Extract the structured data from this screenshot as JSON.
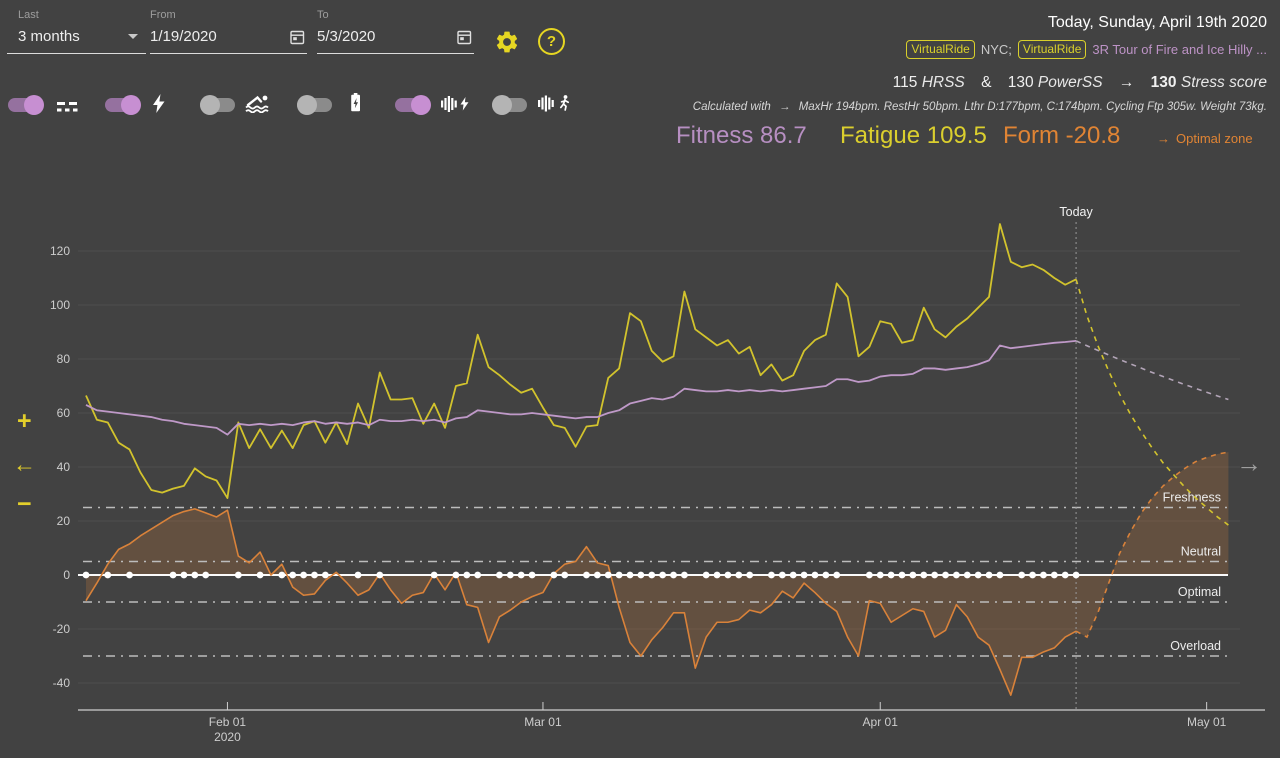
{
  "colors": {
    "background": "#424242",
    "accent_yellow": "#e6d622",
    "fitness_purple": "#b78fc2",
    "fatigue_yellow": "#dbcf2e",
    "form_orange": "#e08434",
    "activity_name_purple": "#bd93c6",
    "toggle_on_purple": "#c78fd2"
  },
  "filters": {
    "last": {
      "label": "Last",
      "value": "3 months"
    },
    "from": {
      "label": "From",
      "value": "1/19/2020"
    },
    "to": {
      "label": "To",
      "value": "5/3/2020"
    }
  },
  "toggles": [
    {
      "name": "trend-lines",
      "on": true
    },
    {
      "name": "power-stress",
      "on": true
    },
    {
      "name": "swim-stress",
      "on": false
    },
    {
      "name": "battery-stress",
      "on": false
    },
    {
      "name": "heart-rate-stress",
      "on": true
    },
    {
      "name": "running-stress",
      "on": false
    }
  ],
  "summary": {
    "date_line": "Today, Sunday, April 19th 2020",
    "activities": [
      {
        "badge": "VirtualRide",
        "name": "NYC;"
      },
      {
        "badge": "VirtualRide",
        "name": "3R Tour of Fire and Ice Hilly ..."
      }
    ],
    "stress": {
      "hrss_value": "115",
      "hrss_label": "HRSS",
      "joiner": "&",
      "powerss_value": "130",
      "powerss_label": "PowerSS",
      "arrow": "→",
      "total_value": "130",
      "total_label": "Stress score"
    },
    "calculated": {
      "prefix": "Calculated with",
      "arrow": "→",
      "details": "MaxHr 194bpm. RestHr 50bpm. Lthr D:177bpm, C:174bpm. Cycling Ftp 305w. Weight 73kg."
    },
    "metrics": [
      {
        "label": "Fitness",
        "value": "86.7"
      },
      {
        "label": "Fatigue",
        "value": "109.5"
      },
      {
        "label": "Form",
        "value": "-20.8"
      }
    ],
    "optimal_zone": {
      "arrow": "→",
      "label": "Optimal zone"
    }
  },
  "controls": {
    "zoom_in": "+",
    "pan_left": "←",
    "zoom_out": "−",
    "pan_right": "→"
  },
  "chart_data": {
    "type": "line",
    "x_start_label": "1/19/2020",
    "x_ticks": [
      {
        "day": 13,
        "label": "Feb 01",
        "sublabel": "2020"
      },
      {
        "day": 42,
        "label": "Mar 01"
      },
      {
        "day": 73,
        "label": "Apr 01"
      },
      {
        "day": 103,
        "label": "May 01"
      }
    ],
    "y_ticks": [
      120,
      100,
      80,
      60,
      40,
      20,
      0,
      -20,
      -40
    ],
    "ylim": [
      -50,
      135
    ],
    "zones": [
      {
        "label": "Freshness",
        "level": 25
      },
      {
        "label": "Neutral",
        "level": 5
      },
      {
        "label": "Optimal",
        "level": -10
      },
      {
        "label": "Overload",
        "level": -30
      }
    ],
    "today": {
      "day": 91,
      "label": "Today"
    },
    "series": [
      {
        "name": "Fitness",
        "color": "#bf99c8",
        "proj_color": "#b3a5b8",
        "values": [
          63,
          61,
          60.5,
          60,
          59.5,
          59,
          58.5,
          57.5,
          57,
          56,
          55.5,
          55,
          54.5,
          52,
          56,
          55.5,
          56,
          55.5,
          56,
          55.5,
          56.5,
          57,
          56,
          56.5,
          56,
          56.5,
          55.5,
          57.5,
          57,
          57,
          57.5,
          57,
          57.5,
          56.5,
          58,
          58.5,
          61,
          60.5,
          60,
          59.5,
          59.5,
          60,
          59.5,
          59,
          58.5,
          58,
          58.5,
          58.5,
          60,
          61,
          63.5,
          64.5,
          65.5,
          65,
          66,
          69,
          68.5,
          68,
          68,
          68.5,
          68,
          68.5,
          68,
          68.5,
          68,
          68.5,
          69,
          69.5,
          70,
          72.5,
          72.5,
          71.5,
          72,
          73.5,
          74,
          74,
          74.5,
          76.5,
          76.5,
          76,
          76.5,
          77,
          78,
          79.5,
          85,
          84,
          84.5,
          85,
          85.5,
          86,
          86.3,
          86.7
        ],
        "projection": [
          86.7,
          84.9,
          83.2,
          81.5,
          79.8,
          78.2,
          76.6,
          75,
          73.5,
          72,
          70.5,
          69.1,
          67.7,
          66.3,
          65
        ]
      },
      {
        "name": "Fatigue",
        "color": "#d2c32d",
        "proj_color": "#d2c32d",
        "values": [
          66.5,
          57.5,
          56.5,
          49,
          46.5,
          38,
          31.5,
          30.5,
          32,
          33,
          39.5,
          36.5,
          35,
          28.5,
          56.5,
          47,
          54,
          47,
          53.5,
          47,
          55.5,
          57,
          49,
          56.5,
          48.5,
          63.5,
          54.5,
          75,
          65,
          65,
          65.5,
          56,
          63.5,
          54.5,
          70,
          71,
          89,
          77,
          74,
          70.5,
          67.5,
          69,
          62,
          55.5,
          54.5,
          47.5,
          55,
          55.5,
          73,
          76.5,
          97,
          94,
          83,
          79,
          81,
          105,
          91,
          88,
          85,
          87,
          82,
          84.5,
          74,
          78,
          72,
          74,
          83,
          87,
          89,
          108,
          103,
          81,
          84.5,
          94,
          93,
          86,
          87,
          99,
          91,
          88,
          92,
          95,
          99,
          103,
          130,
          116,
          114,
          115,
          113,
          110,
          107.5,
          109.5
        ],
        "projection": [
          109.5,
          96,
          85,
          75.5,
          67,
          59.5,
          53,
          47,
          41.5,
          37,
          32.5,
          28.5,
          25,
          21.5,
          18.5
        ]
      },
      {
        "name": "Form",
        "color": "#d9823a",
        "proj_color": "#d9823a",
        "fill": "rgba(217,134,58,0.22)",
        "values": [
          -9.5,
          -3,
          4,
          9.5,
          11.5,
          14.5,
          17,
          19.5,
          22,
          23.5,
          24.5,
          23,
          21.5,
          24,
          7,
          4.5,
          8.5,
          0,
          4,
          -4.5,
          -7.5,
          -7,
          -2,
          1,
          -3,
          -7.5,
          -5.5,
          0.5,
          -5.5,
          -10.5,
          -7.5,
          -6.5,
          0.5,
          -5.5,
          1,
          -11,
          -12,
          -25,
          -15.5,
          -13,
          -10,
          -8,
          -6.5,
          0.5,
          4,
          5,
          10.5,
          4.5,
          3.5,
          -12,
          -25,
          -30,
          -24,
          -19.5,
          -14,
          -14,
          -34.5,
          -23,
          -17.5,
          -17.5,
          -16.5,
          -13,
          -14,
          -11,
          -6,
          -8.5,
          -3,
          -6.5,
          -10.5,
          -13.5,
          -23,
          -30,
          -9.5,
          -10.5,
          -17.5,
          -15,
          -12.5,
          -13.5,
          -23,
          -20.5,
          -11,
          -15.5,
          -23,
          -26,
          -35,
          -44.5,
          -30.5,
          -30.5,
          -28.5,
          -27,
          -23,
          -20.8
        ],
        "projection": [
          -20.8,
          -23,
          -14,
          -3,
          8,
          16,
          23,
          28.5,
          33,
          36.5,
          39.5,
          42,
          43.5,
          44.8,
          45.5
        ]
      }
    ],
    "activity_dot_days": [
      0,
      2,
      4,
      8,
      9,
      10,
      11,
      14,
      16,
      18,
      19,
      20,
      21,
      22,
      25,
      27,
      32,
      34,
      35,
      36,
      38,
      39,
      40,
      41,
      43,
      44,
      46,
      47,
      48,
      49,
      50,
      51,
      52,
      53,
      54,
      55,
      57,
      58,
      59,
      60,
      61,
      63,
      64,
      65,
      66,
      67,
      68,
      69,
      72,
      73,
      74,
      75,
      76,
      77,
      78,
      79,
      80,
      81,
      82,
      83,
      84,
      86,
      87,
      88,
      89,
      90,
      91
    ]
  }
}
